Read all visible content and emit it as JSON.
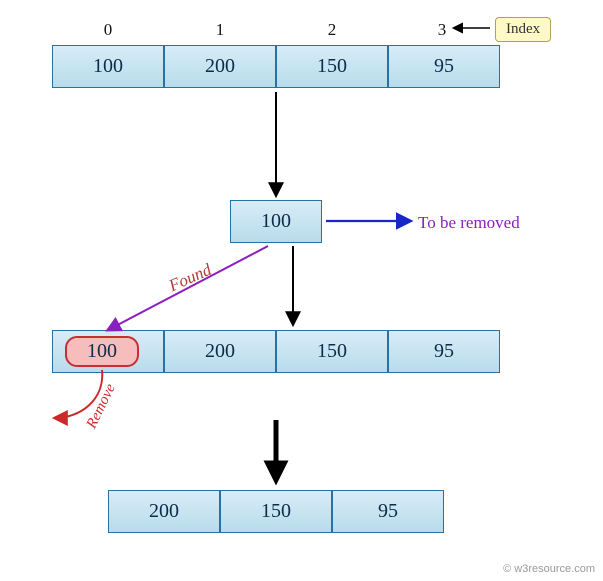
{
  "indices": {
    "i0": "0",
    "i1": "1",
    "i2": "2",
    "i3": "3"
  },
  "index_label": "Index",
  "array1": {
    "c0": "100",
    "c1": "200",
    "c2": "150",
    "c3": "95"
  },
  "target": {
    "value": "100"
  },
  "to_be_removed": "To be removed",
  "found_label": "Found",
  "remove_label": "Remove",
  "array2": {
    "c0": "100",
    "c1": "200",
    "c2": "150",
    "c3": "95"
  },
  "array3": {
    "c0": "200",
    "c1": "150",
    "c2": "95"
  },
  "copyright": "© w3resource.com"
}
